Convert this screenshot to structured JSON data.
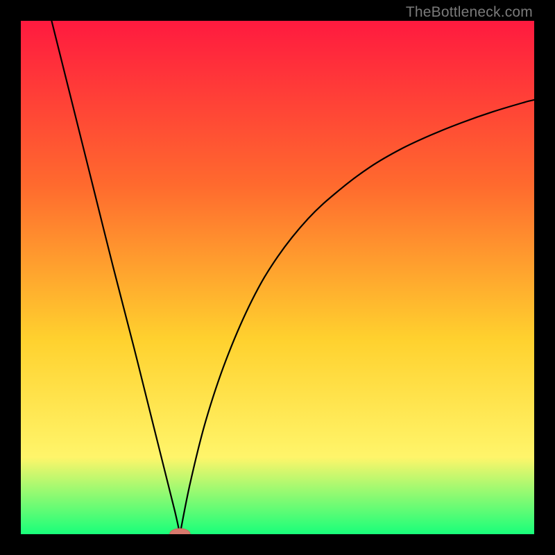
{
  "watermark": "TheBottleneck.com",
  "colors": {
    "black": "#000000",
    "curve": "#000000",
    "marker_fill": "#d8796d",
    "marker_stroke": "#c66a5e",
    "grad_top": "#ff1a3f",
    "grad_mid1": "#ff6a2e",
    "grad_mid2": "#ffd12e",
    "grad_mid3": "#fff56a",
    "grad_bottom": "#18ff7a"
  },
  "chart_data": {
    "type": "line",
    "title": "",
    "xlabel": "",
    "ylabel": "",
    "xlim": [
      0,
      100
    ],
    "ylim": [
      0,
      100
    ],
    "min_x": 31,
    "series": [
      {
        "name": "left-branch",
        "x": [
          6,
          10,
          14,
          18,
          22,
          26,
          28,
          30,
          31
        ],
        "values": [
          100,
          84,
          68,
          52,
          36.5,
          20.5,
          12.5,
          4.5,
          0
        ]
      },
      {
        "name": "right-branch",
        "x": [
          31,
          33,
          36,
          40,
          45,
          50,
          56,
          62,
          68,
          74,
          80,
          86,
          92,
          98,
          100
        ],
        "values": [
          0,
          10,
          22,
          34,
          45.5,
          54,
          61.5,
          67,
          71.5,
          75,
          77.8,
          80.2,
          82.3,
          84.1,
          84.6
        ]
      }
    ],
    "marker": {
      "x": 31,
      "y": 0,
      "rx": 2.0,
      "ry": 1.1
    }
  }
}
